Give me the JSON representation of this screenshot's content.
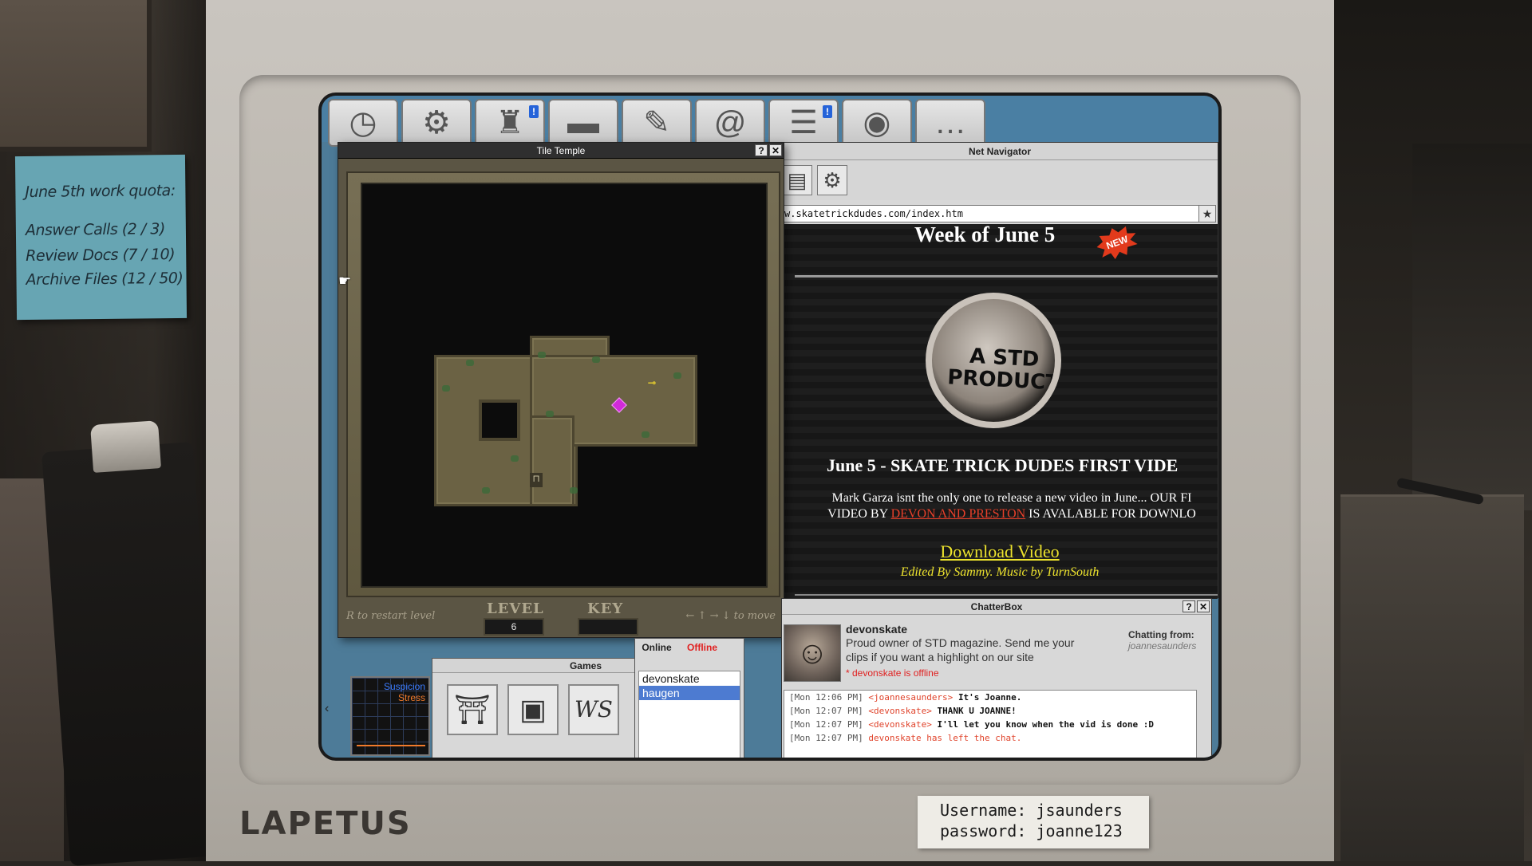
{
  "sticky_note": {
    "title": "June 5th work quota:",
    "lines": [
      "Answer Calls  (2 / 3)",
      "Review Docs  (7 / 10)",
      "Archive Files  (12 / 50)"
    ]
  },
  "monitor": {
    "brand": "LAPETUS",
    "credentials": [
      "Username: jsaunders",
      "password: joanne123"
    ]
  },
  "taskbar": {
    "icons": [
      "clock-icon",
      "gear-icon",
      "stamp-icon",
      "folder-icon",
      "document-pen-icon",
      "clipboard-email-icon",
      "notepad-icon",
      "disc-icon",
      "chat-bubble-icon"
    ],
    "badges": [
      "!",
      "!"
    ]
  },
  "tile_temple": {
    "title": "Tile Temple",
    "help_btn": "?",
    "close_btn": "✕",
    "restart_hint": "R to restart level",
    "move_hint": "← ↑ → ↓ to move",
    "level_label": "LEVEL",
    "level_value": "6",
    "key_label": "KEY",
    "key_value": ""
  },
  "navigator": {
    "title": "Net Navigator",
    "url": "w.skatetrickdudes.com/index.htm",
    "page": {
      "week": "Week of June 5",
      "new_badge": "NEW",
      "video_text": "A STD PRODUCTION",
      "headline": "June 5 - SKATE TRICK DUDES FIRST VIDE",
      "body_1": "Mark Garza isnt the only one to release a new video in June... OUR FI",
      "body_2a": "VIDEO BY ",
      "body_2_link": "DEVON AND PRESTON",
      "body_2b": " IS AVALABLE FOR DOWNLO",
      "download": "Download Video",
      "credit": "Edited By Sammy. Music by TurnSouth"
    }
  },
  "games": {
    "title": "Games",
    "icons": [
      "temple-game-icon",
      "blocks-game-icon",
      "ws-game-icon"
    ],
    "ws_label": "WS"
  },
  "radar": {
    "series": [
      "Suspicion",
      "Stress"
    ],
    "colors": {
      "suspicion": "#3b7cff",
      "stress": "#f07a2b"
    }
  },
  "buddy_list": {
    "tab_online": "Online",
    "tab_offline": "Offline",
    "items": [
      "devonskate",
      "haugen"
    ]
  },
  "chatterbox": {
    "title": "ChatterBox",
    "name": "devonskate",
    "bio": "Proud owner of STD magazine. Send me your clips if you want a highlight on our site",
    "offline": "* devonskate is offline",
    "chatting_from_label": "Chatting from:",
    "chatting_from_user": "joannesaunders",
    "log": [
      {
        "ts": "[Mon 12:06 PM]",
        "who": "<joannesaunders>",
        "msg": "It's Joanne."
      },
      {
        "ts": "[Mon 12:07 PM]",
        "who": "<devonskate>",
        "msg": "THANK U JOANNE!"
      },
      {
        "ts": "[Mon 12:07 PM]",
        "who": "<devonskate>",
        "msg": "I'll let you know when the vid is done :D"
      },
      {
        "ts": "[Mon 12:07 PM]",
        "who": "devonskate has left the chat.",
        "msg": ""
      }
    ]
  }
}
